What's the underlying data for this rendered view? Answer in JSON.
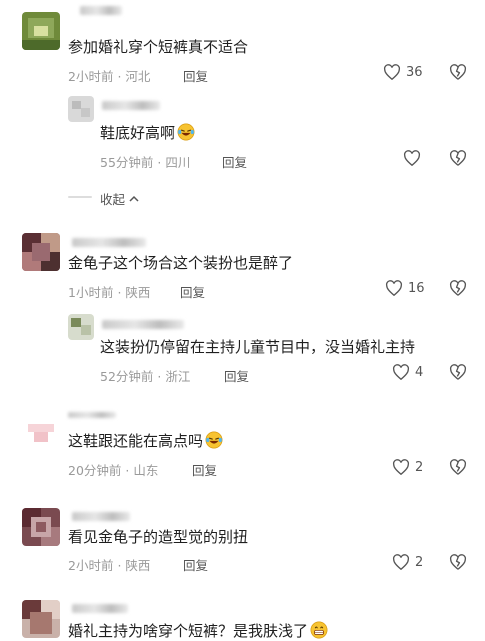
{
  "comments": [
    {
      "text": "参加婚礼穿个短裤真不适合",
      "time": "2小时前",
      "region": "河北",
      "reply": "回复",
      "likes": "36"
    },
    {
      "text": "鞋底好高啊",
      "emoji": "laugh-cry-emoji",
      "time": "55分钟前",
      "region": "四川",
      "reply": "回复",
      "likes": ""
    },
    {
      "text": "金龟子这个场合这个装扮也是醉了",
      "time": "1小时前",
      "region": "陕西",
      "reply": "回复",
      "likes": "16"
    },
    {
      "text": "这装扮仍停留在主持儿童节目中，没当婚礼主持",
      "time": "52分钟前",
      "region": "浙江",
      "reply": "回复",
      "likes": "4"
    },
    {
      "text": "这鞋跟还能在高点吗",
      "emoji": "laugh-cry-emoji",
      "time": "20分钟前",
      "region": "山东",
      "reply": "回复",
      "likes": "2"
    },
    {
      "text": "看见金龟子的造型觉的别扭",
      "time": "2小时前",
      "region": "陕西",
      "reply": "回复",
      "likes": "2"
    },
    {
      "text": "婚礼主持为啥穿个短裤？是我肤浅了",
      "emoji": "grin-emoji"
    }
  ],
  "collapse_label": "收起",
  "separator": "·",
  "colors": {
    "text": "#1f1f1f",
    "meta": "#9a9a9a",
    "icon": "#555555"
  }
}
